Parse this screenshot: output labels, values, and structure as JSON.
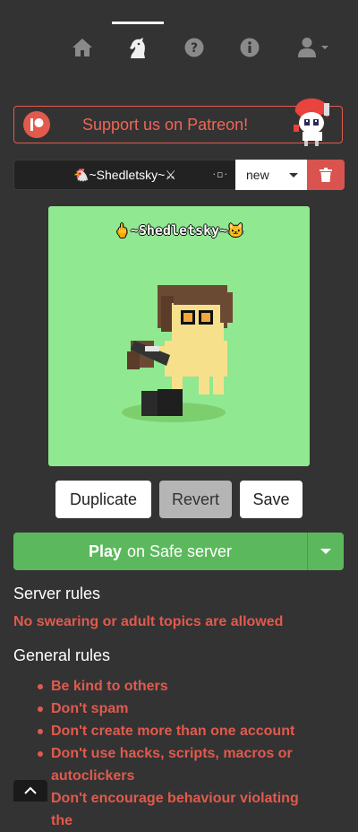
{
  "nav": {
    "items": [
      {
        "icon": "home-icon",
        "active": false
      },
      {
        "icon": "pony-knight-icon",
        "active": true
      },
      {
        "icon": "help-icon",
        "active": false
      },
      {
        "icon": "info-icon",
        "active": false
      },
      {
        "icon": "user-icon",
        "active": false
      }
    ]
  },
  "patreon": {
    "label": "Support us on Patreon!"
  },
  "pony": {
    "name": "🐔~Shedletsky~⚔",
    "slot": "new",
    "preview_name": "🖕~Shedletsky~🐱"
  },
  "buttons": {
    "duplicate": "Duplicate",
    "revert": "Revert",
    "save": "Save"
  },
  "play": {
    "bold": "Play",
    "rest": "on Safe server"
  },
  "server_rules": {
    "title": "Server rules",
    "text": "No swearing or adult topics are allowed"
  },
  "general_rules": {
    "title": "General rules",
    "items": [
      "Be kind to others",
      "Don't spam",
      "Don't create more than one account",
      "Don't use hacks, scripts, macros or autoclickers",
      "Don't encourage behaviour violating the"
    ]
  },
  "colors": {
    "accent": "#e15a4d",
    "play": "#5cb85c",
    "preview_bg": "#90e890",
    "page_bg": "#333333"
  }
}
